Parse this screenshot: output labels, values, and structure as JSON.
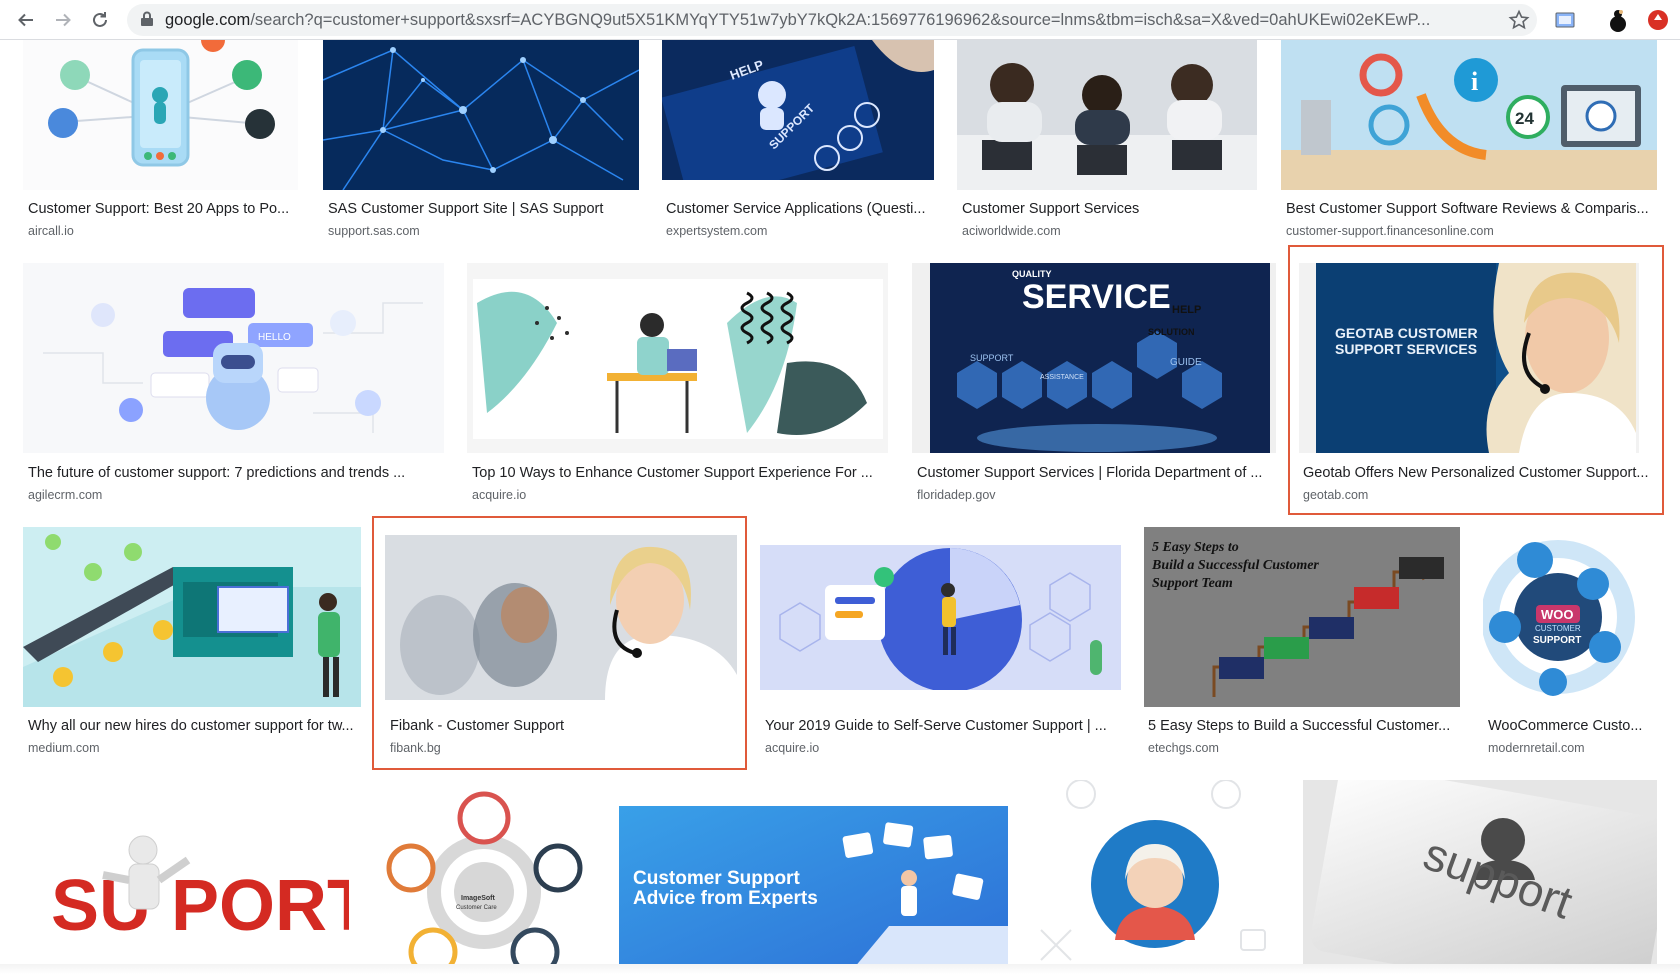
{
  "browser": {
    "url_host": "google.com",
    "url_rest": "/search?q=customer+support&sxsrf=ACYBGNQ9ut5X51KMYqYTY51w7ybY7kQk2A:1569776196962&source=lnms&tbm=isch&sa=X&ved=0ahUKEwi02eKEwP..."
  },
  "results": [
    {
      "title": "Customer Support: Best 20 Apps to Po...",
      "domain": "aircall.io"
    },
    {
      "title": "SAS Customer Support Site | SAS Support",
      "domain": "support.sas.com"
    },
    {
      "title": "Customer Service Applications (Questi...",
      "domain": "expertsystem.com"
    },
    {
      "title": "Customer Support Services",
      "domain": "aciworldwide.com"
    },
    {
      "title": "Best Customer Support Software Reviews & Comparis...",
      "domain": "customer-support.financesonline.com"
    },
    {
      "title": "The future of customer support: 7 predictions and trends ...",
      "domain": "agilecrm.com"
    },
    {
      "title": "Top 10 Ways to Enhance Customer Support Experience For ...",
      "domain": "acquire.io"
    },
    {
      "title": "Customer Support Services | Florida Department of ...",
      "domain": "floridadep.gov"
    },
    {
      "title": "Geotab Offers New Personalized Customer Support...",
      "domain": "geotab.com"
    },
    {
      "title": "Why all our new hires do customer support for tw...",
      "domain": "medium.com"
    },
    {
      "title": "Fibank - Customer Support",
      "domain": "fibank.bg"
    },
    {
      "title": "Your 2019 Guide to Self-Serve Customer Support | ...",
      "domain": "acquire.io"
    },
    {
      "title": "5 Easy Steps to Build a Successful Customer...",
      "domain": "etechgs.com"
    },
    {
      "title": "WooCommerce Custo...",
      "domain": "modernretail.com"
    }
  ],
  "image_text": {
    "geotab": [
      "GEOTAB CUSTOMER",
      "SUPPORT SERVICES"
    ],
    "service": "SERVICE",
    "service_small": [
      "QUALITY",
      "HELP",
      "SOLUTION",
      "GUIDE",
      "SUPPORT",
      "ASSISTANCE"
    ],
    "help_sign": "HELP",
    "support_word": "SUPPORT",
    "hello": "HELLO",
    "steps": [
      "5 Easy Steps to",
      "Build a Successful Customer",
      "Support Team"
    ],
    "woo": [
      "WOO",
      "CUSTOMER",
      "SUPPORT"
    ],
    "advice": [
      "Customer Support",
      "Advice from Experts"
    ],
    "sport": "SU  PORT",
    "key_word": "support",
    "imagesoft": [
      "ImageSoft",
      "Customer Care"
    ],
    "clock_24": "24"
  },
  "colors": {
    "highlight": "#e05a3a",
    "caption": "#202124",
    "domain": "#5f6368"
  }
}
